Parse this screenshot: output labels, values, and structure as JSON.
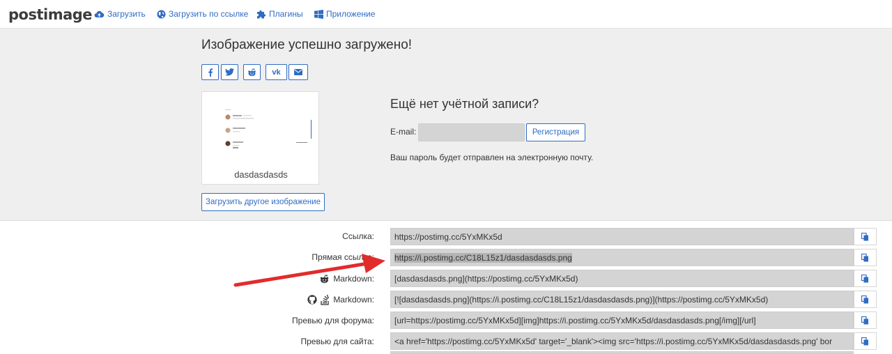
{
  "nav": {
    "logo": "postimage",
    "items": [
      {
        "label": "Загрузить",
        "icon": "cloud-upload-icon"
      },
      {
        "label": "Загрузить по ссылке",
        "icon": "globe-icon"
      },
      {
        "label": "Плагины",
        "icon": "puzzle-icon"
      },
      {
        "label": "Приложение",
        "icon": "windows-icon"
      }
    ]
  },
  "upload": {
    "title": "Изображение успешно загружено!",
    "share": [
      {
        "icon": "facebook-icon"
      },
      {
        "icon": "twitter-icon"
      },
      {
        "icon": "reddit-icon"
      },
      {
        "icon": "vk-icon"
      },
      {
        "icon": "mail-icon"
      }
    ],
    "thumbnail_caption": "dasdasdasds",
    "upload_other_label": "Загрузить другое изображение"
  },
  "account": {
    "title": "Ещё нет учётной записи?",
    "email_label": "E-mail:",
    "email_value": "",
    "register_label": "Регистрация",
    "note": "Ваш пароль будет отправлен на электронную почту."
  },
  "links": [
    {
      "label": "Ссылка:",
      "value": "https://postimg.cc/5YxMKx5d",
      "icons": []
    },
    {
      "label": "Прямая ссылка:",
      "value": "https://i.postimg.cc/C18L15z1/dasdasdasds.png",
      "icons": [],
      "selected": true
    },
    {
      "label": "Markdown:",
      "value": "[dasdasdasds.png](https://postimg.cc/5YxMKx5d)",
      "icons": [
        "reddit-icon"
      ]
    },
    {
      "label": "Markdown:",
      "value": "[![dasdasdasds.png](https://i.postimg.cc/C18L15z1/dasdasdasds.png)](https://postimg.cc/5YxMKx5d)",
      "icons": [
        "github-icon",
        "stackoverflow-icon"
      ]
    },
    {
      "label": "Превью для форума:",
      "value": "[url=https://postimg.cc/5YxMKx5d][img]https://i.postimg.cc/5YxMKx5d/dasdasdasds.png[/img][/url]",
      "icons": []
    },
    {
      "label": "Превью для сайта:",
      "value": "<a href='https://postimg.cc/5YxMKx5d' target='_blank'><img src='https://i.postimg.cc/5YxMKx5d/dasdasdasds.png' bor",
      "icons": []
    }
  ],
  "colors": {
    "accent": "#2f6cc4",
    "arrow": "#e32b2b",
    "field_bg": "#d4d4d4",
    "panel_bg": "#efefef"
  }
}
